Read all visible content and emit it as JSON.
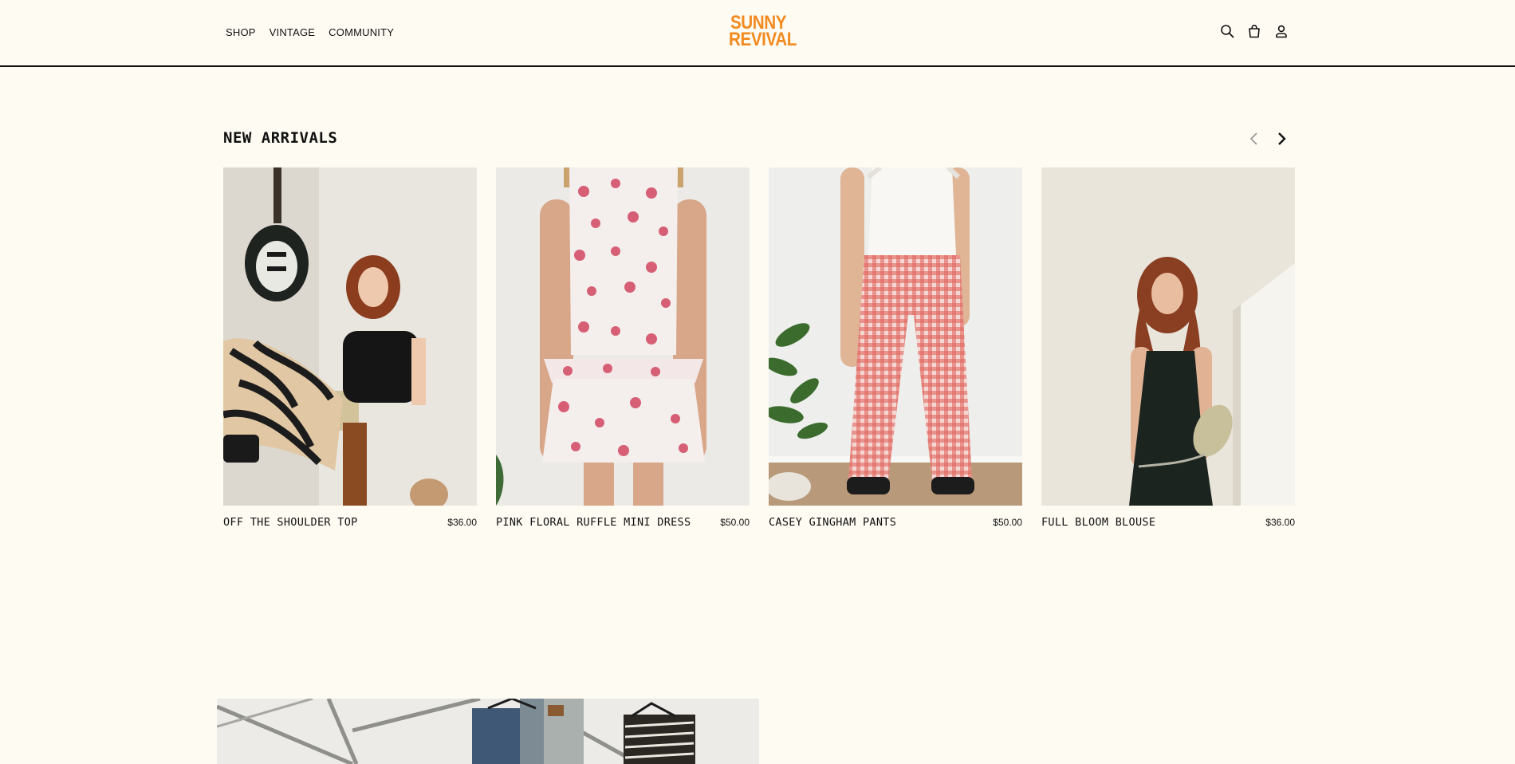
{
  "header": {
    "nav": [
      "SHOP",
      "VINTAGE",
      "COMMUNITY"
    ],
    "logo_line1": "SUNNY",
    "logo_line2": "REVIVAL",
    "icons": [
      "search-icon",
      "bag-icon",
      "account-icon"
    ]
  },
  "new_arrivals": {
    "title": "NEW ARRIVALS",
    "products": [
      {
        "name": "OFF THE SHOULDER TOP",
        "price": "$36.00"
      },
      {
        "name": "PINK FLORAL RUFFLE MINI DRESS",
        "price": "$50.00"
      },
      {
        "name": "CASEY GINGHAM PANTS",
        "price": "$50.00"
      },
      {
        "name": "FULL BLOOM BLOUSE",
        "price": "$36.00"
      }
    ]
  },
  "colors": {
    "background": "#fefbf3",
    "logo": "#f28a1f",
    "text": "#111111"
  }
}
